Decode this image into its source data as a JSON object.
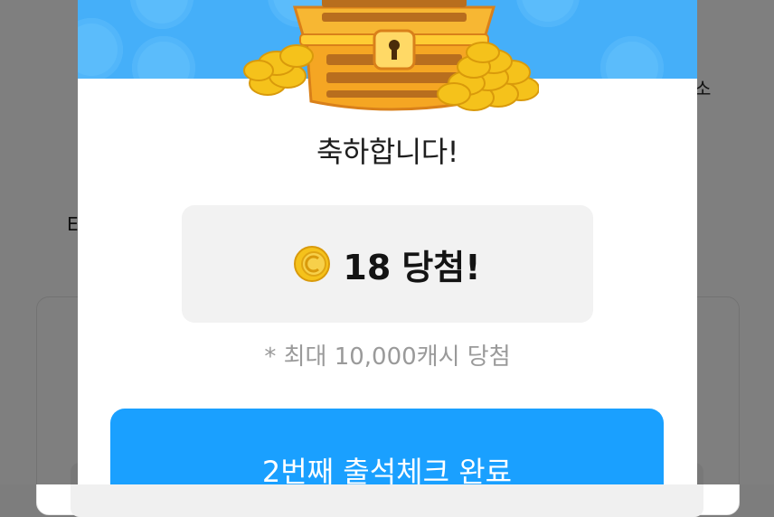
{
  "background_page": {
    "text_e": "E",
    "text_so": "소"
  },
  "modal": {
    "title": "축하합니다!",
    "reward": {
      "amount": "18",
      "label": "당첨!",
      "icon": "coin-icon"
    },
    "note": "* 최대 10,000캐시 당첨",
    "complete_button_label": "2번째 출석체크 완료",
    "banner_icon": "treasure-chest-icon"
  },
  "colors": {
    "banner": "#45aff9",
    "button": "#1aa0ff",
    "coin": "#f5c21b",
    "reward_box": "#f2f2f2"
  }
}
